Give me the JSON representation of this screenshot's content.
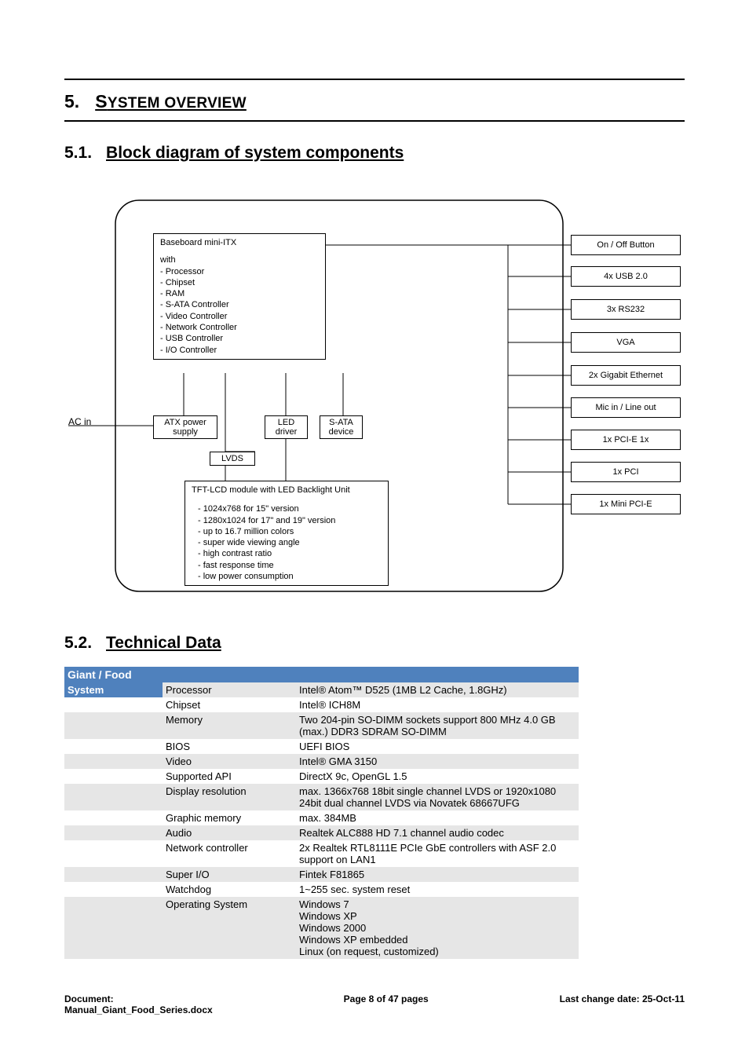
{
  "heading": {
    "num": "5.",
    "title": "System Overview"
  },
  "sub1": {
    "num": "5.1.",
    "title": "Block diagram of system components"
  },
  "sub2": {
    "num": "5.2.",
    "title": "Technical Data"
  },
  "diagram": {
    "ac_in": "AC in",
    "baseboard_title": "Baseboard mini-ITX",
    "baseboard_with": "with",
    "baseboard_items": [
      "- Processor",
      "- Chipset",
      "- RAM",
      "- S-ATA Controller",
      "- Video Controller",
      "- Network Controller",
      "- USB Controller",
      "- I/O Controller"
    ],
    "atx": {
      "l1": "ATX power",
      "l2": "supply"
    },
    "led": {
      "l1": "LED",
      "l2": "driver"
    },
    "sata": {
      "l1": "S-ATA",
      "l2": "device"
    },
    "lvds": "LVDS",
    "tft_title": "TFT-LCD module with LED Backlight Unit",
    "tft_items": [
      "- 1024x768 for 15\" version",
      "- 1280x1024 for 17\" and 19\" version",
      "- up to 16.7 million colors",
      "- super wide viewing angle",
      "- high contrast ratio",
      "- fast response time",
      "- low power consumption"
    ],
    "right": [
      "On / Off Button",
      "4x USB 2.0",
      "3x RS232",
      "VGA",
      "2x Gigabit Ethernet",
      "Mic in / Line out",
      "1x PCI-E 1x",
      "1x PCI",
      "1x Mini PCI-E"
    ]
  },
  "table": {
    "header": "Giant / Food",
    "category": "System",
    "rows": [
      {
        "shade": true,
        "k": "Processor",
        "v": "Intel® Atom™ D525 (1MB L2 Cache, 1.8GHz)"
      },
      {
        "shade": false,
        "k": "Chipset",
        "v": "Intel® ICH8M"
      },
      {
        "shade": true,
        "k": "Memory",
        "v": "Two 204-pin SO-DIMM sockets support 800 MHz 4.0 GB (max.) DDR3 SDRAM SO-DIMM"
      },
      {
        "shade": false,
        "k": "BIOS",
        "v": "UEFI BIOS"
      },
      {
        "shade": true,
        "k": "Video",
        "v": "Intel® GMA 3150"
      },
      {
        "shade": false,
        "k": "Supported API",
        "v": "DirectX 9c, OpenGL 1.5"
      },
      {
        "shade": true,
        "k": "Display resolution",
        "v": "max. 1366x768 18bit single channel LVDS or 1920x1080 24bit dual channel LVDS via Novatek 68667UFG"
      },
      {
        "shade": false,
        "k": "Graphic memory",
        "v": "max. 384MB"
      },
      {
        "shade": true,
        "k": "Audio",
        "v": "Realtek ALC888 HD 7.1 channel audio codec"
      },
      {
        "shade": false,
        "k": "Network controller",
        "v": "2x Realtek RTL8111E PCIe GbE controllers with ASF 2.0 support on LAN1"
      },
      {
        "shade": true,
        "k": "Super I/O",
        "v": "Fintek F81865"
      },
      {
        "shade": false,
        "k": "Watchdog",
        "v": "1~255 sec. system reset"
      },
      {
        "shade": true,
        "k": "Operating System",
        "v": "Windows 7\nWindows XP\nWindows 2000\nWindows XP embedded\nLinux (on request, customized)"
      }
    ]
  },
  "footer": {
    "doc_label": "Document:",
    "doc_name": "Manual_Giant_Food_Series.docx",
    "page": "Page 8 of 47 pages",
    "date": "Last change date: 25-Oct-11"
  }
}
